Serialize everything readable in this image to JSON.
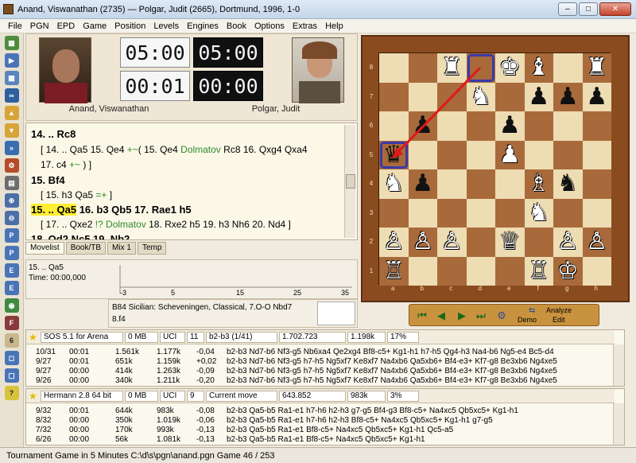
{
  "window": {
    "title": "Anand, Viswanathan (2735)  —  Polgar, Judit (2665),   Dortmund,   1996,   1-0"
  },
  "menu": [
    "File",
    "PGN",
    "EPD",
    "Game",
    "Position",
    "Levels",
    "Engines",
    "Book",
    "Options",
    "Extras",
    "Help"
  ],
  "players": {
    "white_name": "Anand, Viswanathan",
    "black_name": "Polgar, Judit",
    "white_clock_total": "05:00",
    "white_clock_move": "00:01",
    "black_clock_total": "05:00",
    "black_clock_move": "00:00"
  },
  "notation": {
    "l1": "14. .. Rc8",
    "l2a": "[ 14. .. Qa5  15. Qe4 ",
    "l2b": "+~",
    "l2c": "( 15. Qe4 ",
    "l2d": "Dolmatov",
    "l2e": " Rc8  16. Qxg4  Qxa4",
    "l3a": "17. c4 ",
    "l3b": "+~",
    "l3c": " ) ]",
    "l4": "15. Bf4",
    "l5a": "[ 15. h3  Qa5 ",
    "l5b": "=+",
    "l5c": " ]",
    "l6a": "15. .. Qa5",
    "l6b": " 16. b3  Qb5  17. Rae1  h5",
    "l7a": "[ 17. .. Qxe2 ",
    "l7b": "!? Dolmatov",
    "l7c": "  18. Rxe2  h5  19. h3  Nh6  20. Nd4 ]",
    "l8": "18. Qd2  Nc5  19. Nb2"
  },
  "tabs": [
    "Movelist",
    "Book/TB",
    "Mix 1",
    "Temp"
  ],
  "eval": {
    "move": "15. .. Qa5",
    "time": "Time: 00:00,000",
    "ticks": [
      "-3",
      "5",
      "15",
      "25",
      "35"
    ]
  },
  "opening": {
    "eco": "B84   Sicilian: Scheveningen, Classical, 7.O-O Nbd7",
    "move": "8.f4"
  },
  "board": {
    "files": [
      "a",
      "b",
      "c",
      "d",
      "e",
      "f",
      "g",
      "h"
    ],
    "ranks": [
      "8",
      "7",
      "6",
      "5",
      "4",
      "3",
      "2",
      "1"
    ],
    "light": "#eedcb3",
    "dark": "#a86a3a",
    "pieces": [
      {
        "sq": "c8",
        "g": "♜",
        "c": "w"
      },
      {
        "sq": "e8",
        "g": "♚",
        "c": "w"
      },
      {
        "sq": "f8",
        "g": "♝",
        "c": "w"
      },
      {
        "sq": "h8",
        "g": "♜",
        "c": "w"
      },
      {
        "sq": "d7",
        "g": "♞",
        "c": "w"
      },
      {
        "sq": "f7",
        "g": "♟",
        "c": "b"
      },
      {
        "sq": "g7",
        "g": "♟",
        "c": "b"
      },
      {
        "sq": "h7",
        "g": "♟",
        "c": "b"
      },
      {
        "sq": "b6",
        "g": "♟",
        "c": "b"
      },
      {
        "sq": "e6",
        "g": "♟",
        "c": "b"
      },
      {
        "sq": "a5",
        "g": "♛",
        "c": "b"
      },
      {
        "sq": "e5",
        "g": "♟",
        "c": "w"
      },
      {
        "sq": "a4",
        "g": "♞",
        "c": "w"
      },
      {
        "sq": "b4",
        "g": "♟",
        "c": "b"
      },
      {
        "sq": "f4",
        "g": "♗",
        "c": "w"
      },
      {
        "sq": "g4",
        "g": "♞",
        "c": "b"
      },
      {
        "sq": "f3",
        "g": "♞",
        "c": "w"
      },
      {
        "sq": "a2",
        "g": "♙",
        "c": "w"
      },
      {
        "sq": "b2",
        "g": "♙",
        "c": "w"
      },
      {
        "sq": "c2",
        "g": "♙",
        "c": "w"
      },
      {
        "sq": "e2",
        "g": "♕",
        "c": "w"
      },
      {
        "sq": "g2",
        "g": "♙",
        "c": "w"
      },
      {
        "sq": "h2",
        "g": "♙",
        "c": "w"
      },
      {
        "sq": "a1",
        "g": "♖",
        "c": "w"
      },
      {
        "sq": "f1",
        "g": "♖",
        "c": "w"
      },
      {
        "sq": "g1",
        "g": "♔",
        "c": "w"
      }
    ]
  },
  "nav": {
    "demo": "Demo",
    "analyze": "Analyze",
    "edit": "Edit"
  },
  "engine1": {
    "name": "SOS 5.1 for Arena",
    "mem": "0 MB",
    "proto": "UCI",
    "depth": "11",
    "move": "b2-b3 (1/41)",
    "nodes": "1.702.723",
    "nps": "1.198k",
    "load": "17%",
    "rows": [
      [
        "10/31",
        "00:01",
        "1.561k",
        "1.177k",
        "-0,04",
        "b2-b3  Nd7-b6  Nf3-g5  Nb6xa4  Qe2xg4  Bf8-c5+  Kg1-h1  h7-h5  Qg4-h3  Na4-b6  Ng5-e4  Bc5-d4"
      ],
      [
        "9/27",
        "00:01",
        "651k",
        "1.159k",
        "+0,02",
        "b2-b3  Nd7-b6  Nf3-g5  h7-h5  Ng5xf7  Ke8xf7  Na4xb6  Qa5xb6+  Bf4-e3+  Kf7-g8  Be3xb6  Ng4xe5"
      ],
      [
        "9/27",
        "00:00",
        "414k",
        "1.263k",
        "-0,09",
        "b2-b3  Nd7-b6  Nf3-g5  h7-h5  Ng5xf7  Ke8xf7  Na4xb6  Qa5xb6+  Bf4-e3+  Kf7-g8  Be3xb6  Ng4xe5"
      ],
      [
        "9/26",
        "00:00",
        "340k",
        "1.211k",
        "-0,20",
        "b2-b3  Nd7-b6  Nf3-g5  h7-h5  Ng5xf7  Ke8xf7  Na4xb6  Qa5xb6+  Bf4-e3+  Kf7-g8  Be3xb6  Ng4xe5"
      ]
    ]
  },
  "engine2": {
    "name": "Hermann 2.8 64 bit",
    "mem": "0 MB",
    "proto": "UCI",
    "depth": "9",
    "move": "Current move",
    "nodes": "643.852",
    "nps": "983k",
    "load": "3%",
    "rows": [
      [
        "9/32",
        "00:01",
        "644k",
        "983k",
        "-0,08",
        "b2-b3  Qa5-b5  Ra1-e1  h7-h6  h2-h3  g7-g5  Bf4-g3  Bf8-c5+  Na4xc5  Qb5xc5+  Kg1-h1"
      ],
      [
        "8/32",
        "00:00",
        "350k",
        "1.019k",
        "-0,06",
        "b2-b3  Qa5-b5  Ra1-e1  h7-h6  h2-h3  Bf8-c5+  Na4xc5  Qb5xc5+  Kg1-h1  g7-g5"
      ],
      [
        "7/32",
        "00:00",
        "170k",
        "993k",
        "-0,13",
        "b2-b3  Qa5-b5  Ra1-e1  Bf8-c5+  Na4xc5  Qb5xc5+  Kg1-h1  Qc5-a5"
      ],
      [
        "6/26",
        "00:00",
        "56k",
        "1.081k",
        "-0,13",
        "b2-b3  Qa5-b5  Ra1-e1  Bf8-c5+  Na4xc5  Qb5xc5+  Kg1-h1"
      ]
    ]
  },
  "status": {
    "text": "Tournament Game in 5 Minutes   C:\\d\\s\\pgn\\anand.pgn   Game 46 / 253"
  }
}
